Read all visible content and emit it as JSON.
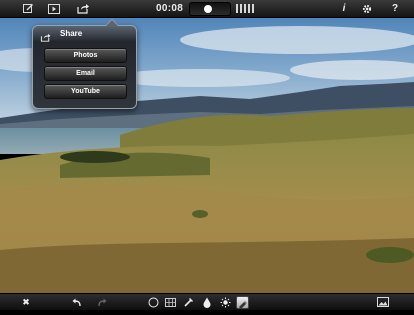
{
  "toolbar": {
    "timecode": "00:08",
    "icons": {
      "edit": "edit-icon",
      "preview": "play-preview-icon",
      "share": "share-icon",
      "info": "info-icon",
      "settings": "gear-icon",
      "help": "help-icon"
    },
    "info_glyph": "i",
    "help_glyph": "?",
    "playback_position": 0.45
  },
  "share_menu": {
    "title": "Share",
    "options": [
      {
        "label": "Photos"
      },
      {
        "label": "Email"
      },
      {
        "label": "YouTube"
      }
    ]
  },
  "bottom_bar": {
    "close_glyph": "✖",
    "icons": {
      "close": "close-icon",
      "undo": "undo-icon",
      "redo": "redo-icon",
      "circle": "circle-tool-icon",
      "grid": "grid-tool-icon",
      "brush": "brush-tool-icon",
      "drop": "drop-tool-icon",
      "brightness": "brightness-tool-icon",
      "eraser": "eraser-tool-icon",
      "photo": "photo-library-icon"
    },
    "active_tool": "eraser"
  },
  "colors": {
    "bar_dark": "#141414",
    "popover_border": "#9aa3ad"
  }
}
